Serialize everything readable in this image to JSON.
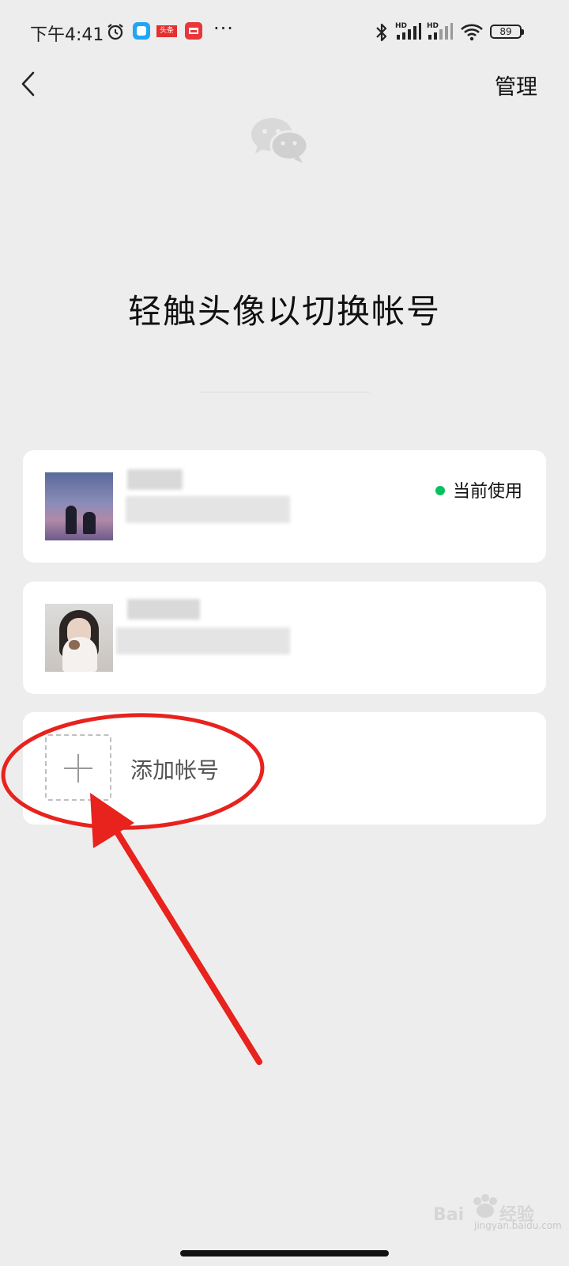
{
  "status_bar": {
    "time": "下午4:41",
    "app_badge": "头条",
    "more": "···",
    "battery": "89"
  },
  "header": {
    "manage_label": "管理"
  },
  "title": "轻触头像以切换帐号",
  "accounts": [
    {
      "status": "当前使用",
      "status_color": "#07c160"
    },
    {
      "status": ""
    }
  ],
  "add_account_label": "添加帐号",
  "watermark": {
    "text": "jingyan.baidu.com",
    "logo_text": "Baidu经验"
  },
  "colors": {
    "background": "#ededed",
    "card": "#ffffff",
    "accent_green": "#07c160",
    "annotation_red": "#e8221d"
  }
}
